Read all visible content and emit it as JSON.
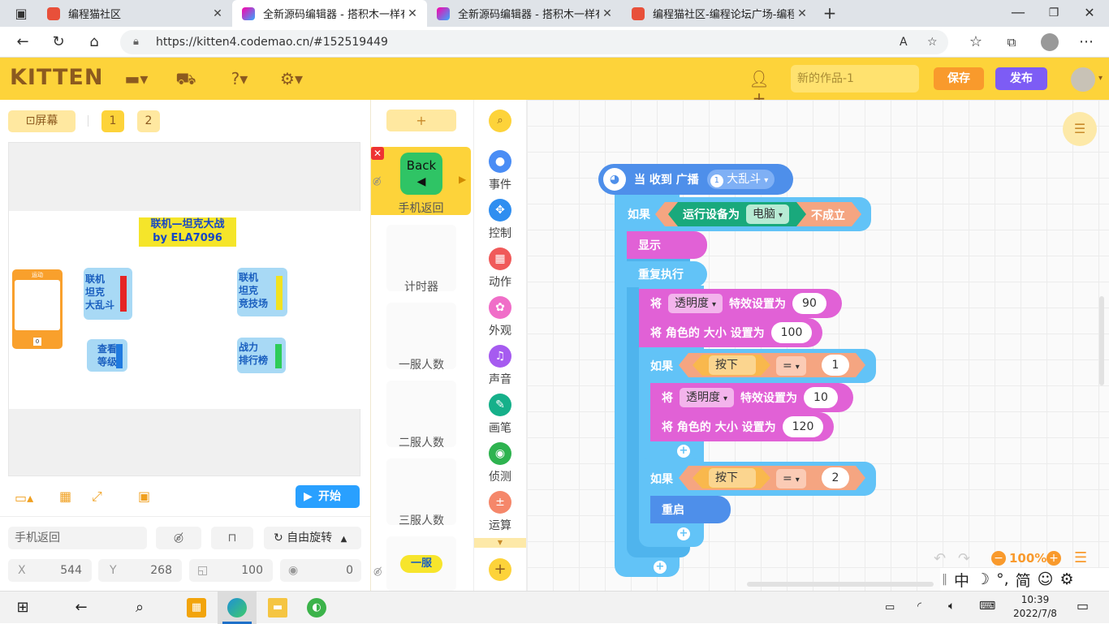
{
  "browser": {
    "tabs": [
      {
        "title": "编程猫社区",
        "active": false
      },
      {
        "title": "全新源码编辑器 - 搭积木一样有趣",
        "active": true
      },
      {
        "title": "全新源码编辑器 - 搭积木一样有趣",
        "active": false
      },
      {
        "title": "编程猫社区-编程论坛广场-编程学习",
        "active": false
      }
    ],
    "url": "https://kitten4.codemao.cn/#152519449"
  },
  "app": {
    "logo": "KITTEN",
    "work_title_placeholder": "新的作品-1",
    "save_label": "保存",
    "publish_label": "发布"
  },
  "stage": {
    "screen_label": "屏幕",
    "screens": [
      "1",
      "2"
    ],
    "title_line1": "联机—坦克大战",
    "title_line2": "by ELA7096",
    "card_label": "运动",
    "card_counter": "0",
    "btn_battle": "联机\n坦克\n大乱斗",
    "btn_arena": "联机\n坦克\n竞技场",
    "btn_level": "查看\n等级",
    "btn_rank": "战力\n排行榜",
    "start_label": "开始"
  },
  "sprite_props": {
    "name": "手机返回",
    "rotation_label": "自由旋转",
    "x_label": "X",
    "x": "544",
    "y_label": "Y",
    "y": "268",
    "size": "100",
    "direction": "0"
  },
  "sprites": {
    "add_label": "+",
    "back_text": "Back",
    "items": [
      "手机返回",
      "计时器",
      "一服人数",
      "二服人数",
      "三服人数"
    ],
    "last_badge": "一服"
  },
  "categories": [
    {
      "label": "事件",
      "color": "#4a8df5"
    },
    {
      "label": "控制",
      "color": "#2f8ef0"
    },
    {
      "label": "动作",
      "color": "#f05a5a"
    },
    {
      "label": "外观",
      "color": "#f06ec8"
    },
    {
      "label": "声音",
      "color": "#a65bf0"
    },
    {
      "label": "画笔",
      "color": "#16b08a"
    },
    {
      "label": "侦测",
      "color": "#2eb34f"
    },
    {
      "label": "运算",
      "color": "#f5876a"
    }
  ],
  "blocks": {
    "hat_label": "当 收到 广播",
    "hat_badge": "1",
    "hat_value": "大乱斗",
    "if1": "如果",
    "device_label": "运行设备为",
    "device_value": "电脑",
    "not_label": "不成立",
    "show": "显示",
    "repeat": "重复执行",
    "set_word": "将",
    "effect1": "透明度",
    "effect_set": "特效设置为",
    "val90": "90",
    "size_set": "将 角色的 大小 设置为",
    "val100": "100",
    "if2": "如果",
    "key_b": "按下b",
    "eq": "=",
    "val1": "1",
    "effect2": "透明度",
    "val10": "10",
    "val120": "120",
    "if3": "如果",
    "key_b2": "按下b",
    "eq2": "=",
    "val2": "2",
    "restart": "重启"
  },
  "zoom": "100%",
  "ime": [
    "中",
    "°,",
    "简"
  ],
  "taskbar": {
    "time": "10:39",
    "date": "2022/7/8"
  }
}
